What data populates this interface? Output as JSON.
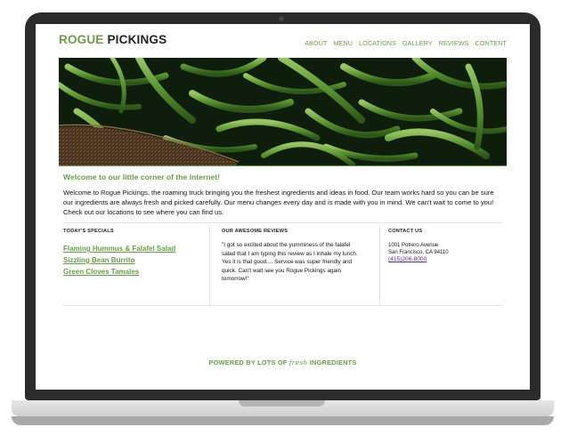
{
  "logo": {
    "word1": "ROGUE",
    "word2": "PICKINGS"
  },
  "nav": [
    {
      "label": "ABOUT"
    },
    {
      "label": "MENU"
    },
    {
      "label": "LOCATIONS"
    },
    {
      "label": "GALLERY"
    },
    {
      "label": "REVIEWS"
    },
    {
      "label": "CONTENT"
    }
  ],
  "hero": {
    "subject": "green-beans-photo"
  },
  "welcome": {
    "title": "Welcome to our little corner of the internet!",
    "body": "Welcome to Rogue Pickings, the roaming truck bringing you the freshest ingredients and ideas in food. Our team works hard so you can be sure our ingredients are always fresh and picked carefully. Our menu changes every day and is made with you in mind. We can't wait to come to you! Check out our locations to see where you can find us."
  },
  "specials": {
    "heading": "TODAY'S SPECIALS",
    "items": [
      {
        "label": "Flaming Hummus & Falafel Salad"
      },
      {
        "label": "Sizzling Bean Burrito"
      },
      {
        "label": "Green Cloves Tamales"
      }
    ]
  },
  "reviews": {
    "heading": "OUR AWESOME REVIEWS",
    "quote": "\"I got so excited about the yumminess of the falafel salad that I am typing this review as I inhale my lunch. Yes it is that good.... Service was super friendly and quick. Can't wait see you Rogue Pickings again tomorrow!\""
  },
  "contact": {
    "heading": "CONTACT US",
    "address1": "1001 Potrero Avenue",
    "address2": "San Francisco, CA 94110",
    "phone": "(415)206-8000"
  },
  "footer": {
    "prefix": "POWERED BY LOTS OF",
    "script": "fresh",
    "suffix": "INGREDIENTS"
  },
  "colors": {
    "accent": "#6a9c4a",
    "frame": "#2b2b2b",
    "link_visited": "#5b2a8a"
  }
}
